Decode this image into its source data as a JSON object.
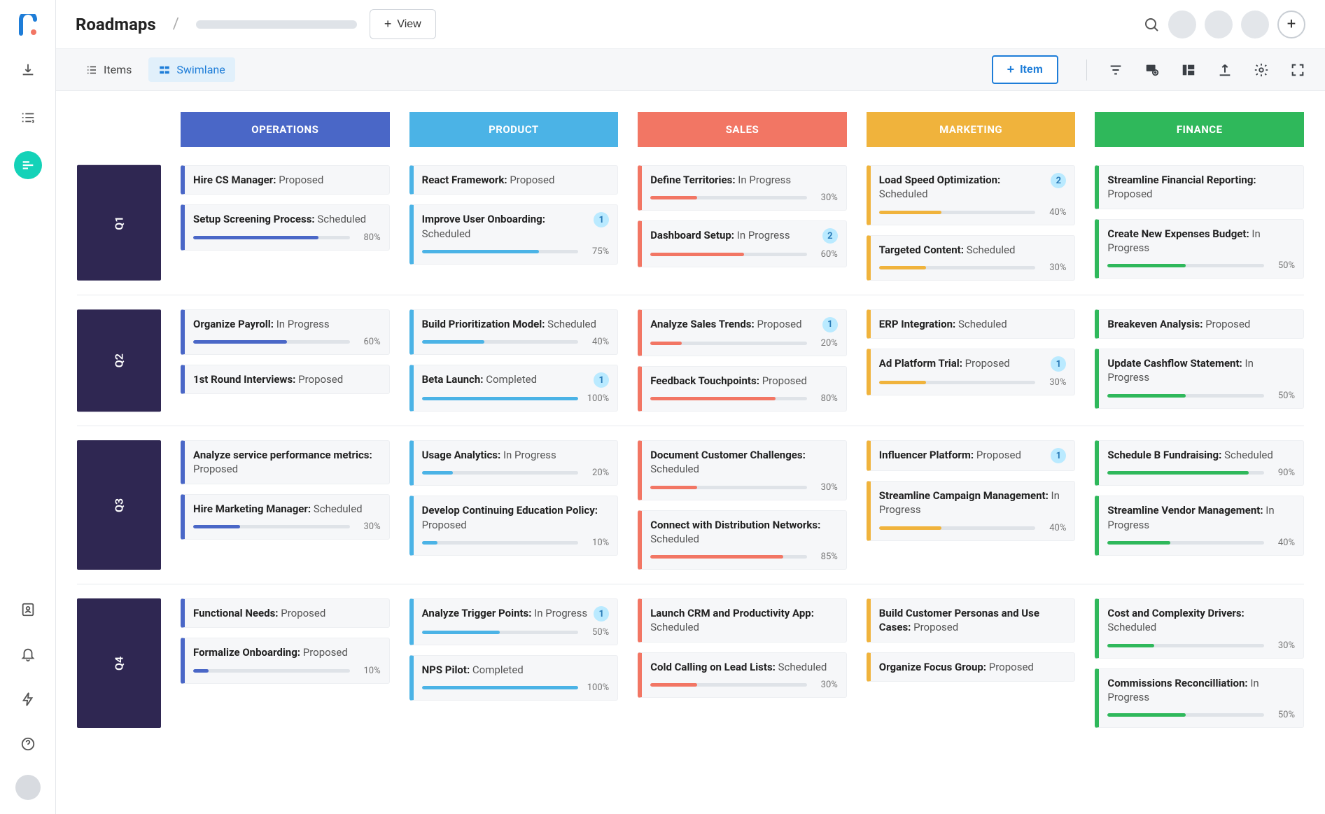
{
  "header": {
    "title": "Roadmaps",
    "view_btn": "View",
    "add_item": "Item"
  },
  "tabs": {
    "items": "Items",
    "swimlane": "Swimlane"
  },
  "lanes": [
    {
      "key": "ops",
      "label": "OPERATIONS"
    },
    {
      "key": "prod",
      "label": "PRODUCT"
    },
    {
      "key": "sales",
      "label": "SALES"
    },
    {
      "key": "mkt",
      "label": "MARKETING"
    },
    {
      "key": "fin",
      "label": "FINANCE"
    }
  ],
  "rows": [
    {
      "label": "Q1",
      "cells": {
        "ops": [
          {
            "title": "Hire CS Manager:",
            "status": "Proposed"
          },
          {
            "title": "Setup Screening Process:",
            "status": "Scheduled",
            "progress": 80
          }
        ],
        "prod": [
          {
            "title": "React Framework:",
            "status": "Proposed"
          },
          {
            "title": "Improve User Onboarding:",
            "status": "Scheduled",
            "badge": 1,
            "progress": 75
          }
        ],
        "sales": [
          {
            "title": "Define Territories:",
            "status": "In Progress",
            "progress": 30
          },
          {
            "title": "Dashboard Setup:",
            "status": "In Progress",
            "badge": 2,
            "progress": 60
          }
        ],
        "mkt": [
          {
            "title": "Load Speed Optimization:",
            "status": "Scheduled",
            "badge": 2,
            "progress": 40
          },
          {
            "title": "Targeted Content:",
            "status": "Scheduled",
            "progress": 30
          }
        ],
        "fin": [
          {
            "title": "Streamline Financial Reporting:",
            "status": "Proposed"
          },
          {
            "title": "Create New Expenses Budget:",
            "status": "In Progress",
            "progress": 50
          }
        ]
      }
    },
    {
      "label": "Q2",
      "cells": {
        "ops": [
          {
            "title": "Organize Payroll:",
            "status": "In Progress",
            "progress": 60
          },
          {
            "title": "1st Round Interviews:",
            "status": "Proposed"
          }
        ],
        "prod": [
          {
            "title": "Build Prioritization Model:",
            "status": "Scheduled",
            "progress": 40
          },
          {
            "title": "Beta Launch:",
            "status": "Completed",
            "badge": 1,
            "progress": 100
          }
        ],
        "sales": [
          {
            "title": "Analyze Sales Trends:",
            "status": "Proposed",
            "badge": 1,
            "progress": 20
          },
          {
            "title": "Feedback Touchpoints:",
            "status": "Proposed",
            "progress": 80
          }
        ],
        "mkt": [
          {
            "title": "ERP Integration:",
            "status": "Scheduled"
          },
          {
            "title": "Ad Platform Trial:",
            "status": "Proposed",
            "badge": 1,
            "progress": 30
          }
        ],
        "fin": [
          {
            "title": "Breakeven Analysis:",
            "status": "Proposed"
          },
          {
            "title": "Update Cashflow Statement:",
            "status": "In Progress",
            "progress": 50
          }
        ]
      }
    },
    {
      "label": "Q3",
      "cells": {
        "ops": [
          {
            "title": "Analyze service performance metrics:",
            "status": "Proposed"
          },
          {
            "title": "Hire Marketing Manager:",
            "status": "Scheduled",
            "progress": 30
          }
        ],
        "prod": [
          {
            "title": "Usage Analytics:",
            "status": "In Progress",
            "progress": 20
          },
          {
            "title": "Develop Continuing Education Policy:",
            "status": "Proposed",
            "progress": 10
          }
        ],
        "sales": [
          {
            "title": "Document Customer Challenges:",
            "status": "Scheduled",
            "progress": 30
          },
          {
            "title": "Connect with Distribution Networks:",
            "status": "Scheduled",
            "progress": 85
          }
        ],
        "mkt": [
          {
            "title": "Influencer Platform:",
            "status": "Proposed",
            "badge": 1
          },
          {
            "title": "Streamline Campaign Management:",
            "status": "In Progress",
            "progress": 40
          }
        ],
        "fin": [
          {
            "title": "Schedule B Fundraising:",
            "status": "Scheduled",
            "progress": 90
          },
          {
            "title": "Streamline Vendor Management:",
            "status": "In Progress",
            "progress": 40
          }
        ]
      }
    },
    {
      "label": "Q4",
      "cells": {
        "ops": [
          {
            "title": "Functional Needs:",
            "status": "Proposed"
          },
          {
            "title": "Formalize Onboarding:",
            "status": "Proposed",
            "progress": 10
          }
        ],
        "prod": [
          {
            "title": "Analyze Trigger Points:",
            "status": "In Progress",
            "badge": 1,
            "progress": 50
          },
          {
            "title": "NPS Pilot:",
            "status": "Completed",
            "progress": 100
          }
        ],
        "sales": [
          {
            "title": "Launch CRM and Productivity App:",
            "status": "Scheduled"
          },
          {
            "title": "Cold Calling on Lead Lists:",
            "status": "Scheduled",
            "progress": 30
          }
        ],
        "mkt": [
          {
            "title": "Build Customer Personas and Use Cases:",
            "status": "Proposed"
          },
          {
            "title": "Organize Focus Group:",
            "status": "Proposed"
          }
        ],
        "fin": [
          {
            "title": "Cost and Complexity Drivers:",
            "status": "Scheduled",
            "progress": 30
          },
          {
            "title": "Commissions Reconcilliation:",
            "status": "In Progress",
            "progress": 50
          }
        ]
      }
    }
  ]
}
